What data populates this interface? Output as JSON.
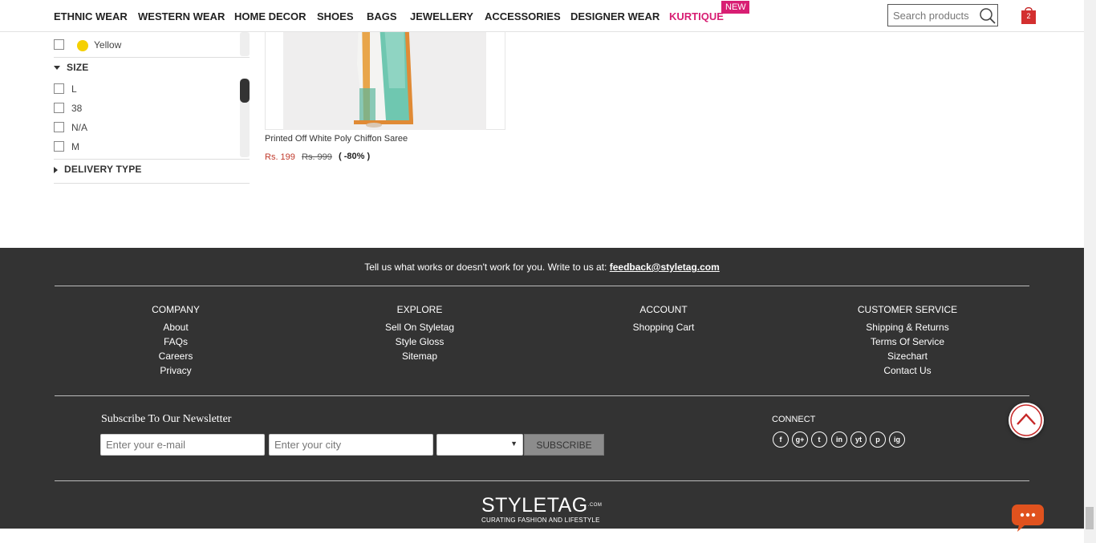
{
  "nav": {
    "items": [
      {
        "label": "ETHNIC WEAR"
      },
      {
        "label": "WESTERN WEAR"
      },
      {
        "label": "HOME DECOR"
      },
      {
        "label": "SHOES"
      },
      {
        "label": "BAGS"
      },
      {
        "label": "JEWELLERY"
      },
      {
        "label": "ACCESSORIES"
      },
      {
        "label": "DESIGNER WEAR"
      },
      {
        "label": "KURTIQUE"
      }
    ],
    "new_badge": "NEW",
    "search_placeholder": "Search products",
    "cart_count": "2"
  },
  "filters": {
    "colour_items": [
      {
        "label": "Yellow",
        "color": "#f5d000"
      }
    ],
    "size_title": "SIZE",
    "size_items": [
      {
        "label": "L"
      },
      {
        "label": "38"
      },
      {
        "label": "N/A"
      },
      {
        "label": "M"
      }
    ],
    "delivery_title": "DELIVERY TYPE"
  },
  "product": {
    "name": "Printed Off White Poly Chiffon Saree",
    "price": "Rs. 199",
    "mrp": "Rs. 999",
    "discount": "( -80% )"
  },
  "footer": {
    "feedback_text": "Tell us what works or doesn't work for you. Write to us at:",
    "feedback_email": "feedback@styletag.com",
    "columns": [
      {
        "title": "COMPANY",
        "links": [
          "About",
          "FAQs",
          "Careers",
          "Privacy"
        ]
      },
      {
        "title": "EXPLORE",
        "links": [
          "Sell On Styletag",
          "Style Gloss",
          "Sitemap"
        ]
      },
      {
        "title": "ACCOUNT",
        "links": [
          "Shopping Cart"
        ]
      },
      {
        "title": "CUSTOMER SERVICE",
        "links": [
          "Shipping & Returns",
          "Terms Of Service",
          "Sizechart",
          "Contact Us"
        ]
      }
    ],
    "newsletter_title": "Subscribe To Our Newsletter",
    "email_placeholder": "Enter your e-mail",
    "city_placeholder": "Enter your city",
    "subscribe_label": "SUBSCRIBE",
    "connect_title": "CONNECT",
    "social": [
      {
        "icon": "facebook-icon",
        "glyph": "f"
      },
      {
        "icon": "google-plus-icon",
        "glyph": "g+"
      },
      {
        "icon": "twitter-icon",
        "glyph": "t"
      },
      {
        "icon": "linkedin-icon",
        "glyph": "in"
      },
      {
        "icon": "youtube-icon",
        "glyph": "yt"
      },
      {
        "icon": "pinterest-icon",
        "glyph": "p"
      },
      {
        "icon": "instagram-icon",
        "glyph": "ig"
      }
    ],
    "logo_word": "STYLETAG",
    "logo_com": ".COM",
    "logo_tagline": "CURATING FASHION AND LIFESTYLE"
  },
  "colors": {
    "accent": "#d81e73",
    "price_red": "#c0392b",
    "footer_bg": "#333333",
    "chat_orange": "#e0521e"
  }
}
